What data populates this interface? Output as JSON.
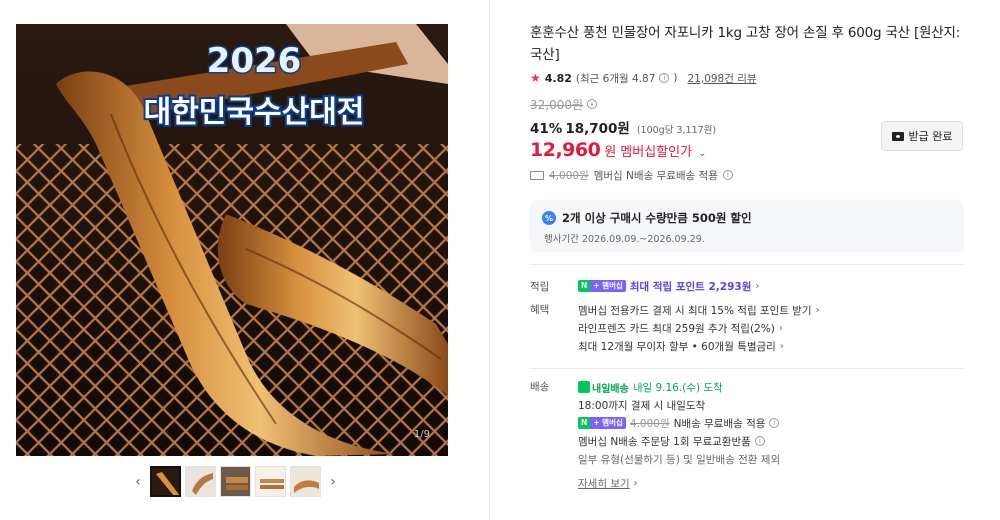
{
  "gallery": {
    "overlay_year": "2026",
    "overlay_event": "대한민국수산대전",
    "counter": "1/9",
    "thumbs_count": 5,
    "prev_arrow": "‹",
    "next_arrow": "›"
  },
  "product": {
    "title": "훈훈수산 풍천 민물장어 자포니카 1kg 고창 장어 손질 후 600g 국산 [원산지:국산]",
    "rating": {
      "score": "4.82",
      "recent_text": "(최근 6개월 4.87",
      "recent_close": ")",
      "reviews": "21,098건 리뷰"
    },
    "original_price": "32,000원",
    "discount_rate": "41%",
    "sale_price": "18,700원",
    "unit_price": "(100g당 3,117원)",
    "member_price": "12,960",
    "member_won": "원",
    "member_label": "멤버십할인가",
    "coupon_button": "받급 완료",
    "shipping_line": {
      "strike": "4,000원",
      "text": "멤버십 N배송 무료배송 적용"
    }
  },
  "promo": {
    "badge": "%",
    "title": "2개 이상 구매시 수량만큼 500원 할인",
    "period": "행사기간 2026.09.09.~2026.09.29."
  },
  "points": {
    "label": "적립",
    "badge_n": "N",
    "badge_m": "+ 멤버십",
    "text": "최대 적립 포인트 2,293원"
  },
  "benefits": {
    "label": "혜택",
    "items": [
      "멤버십 전용카드 결제 시 최대 15% 적립 포인트 받기",
      "라인프렌즈 카드 최대 259원 추가 적립(2%)",
      "최대 12개월 무이자 할부 • 60개월 특별금리"
    ]
  },
  "delivery": {
    "label": "배송",
    "badge_text": "내일배송",
    "arrival": "내일 9.16.(수) 도착",
    "cutoff": "18:00까지 결제 시 내일도착",
    "badge_n": "N",
    "badge_m": "+ 멤버십",
    "fee_strike": "4,000원",
    "fee_text": "N배송 무료배송 적용",
    "exchange": "멤버십 N배송 주문당 1회 무료교환반품",
    "exception": "일부 유형(선물하기 등) 및 일반배송 전환 제외",
    "more": "자세히 보기"
  },
  "colors": {
    "accent_red": "#e21b3c",
    "naver_green": "#03c75a",
    "membership_purple": "#5c3df5"
  }
}
